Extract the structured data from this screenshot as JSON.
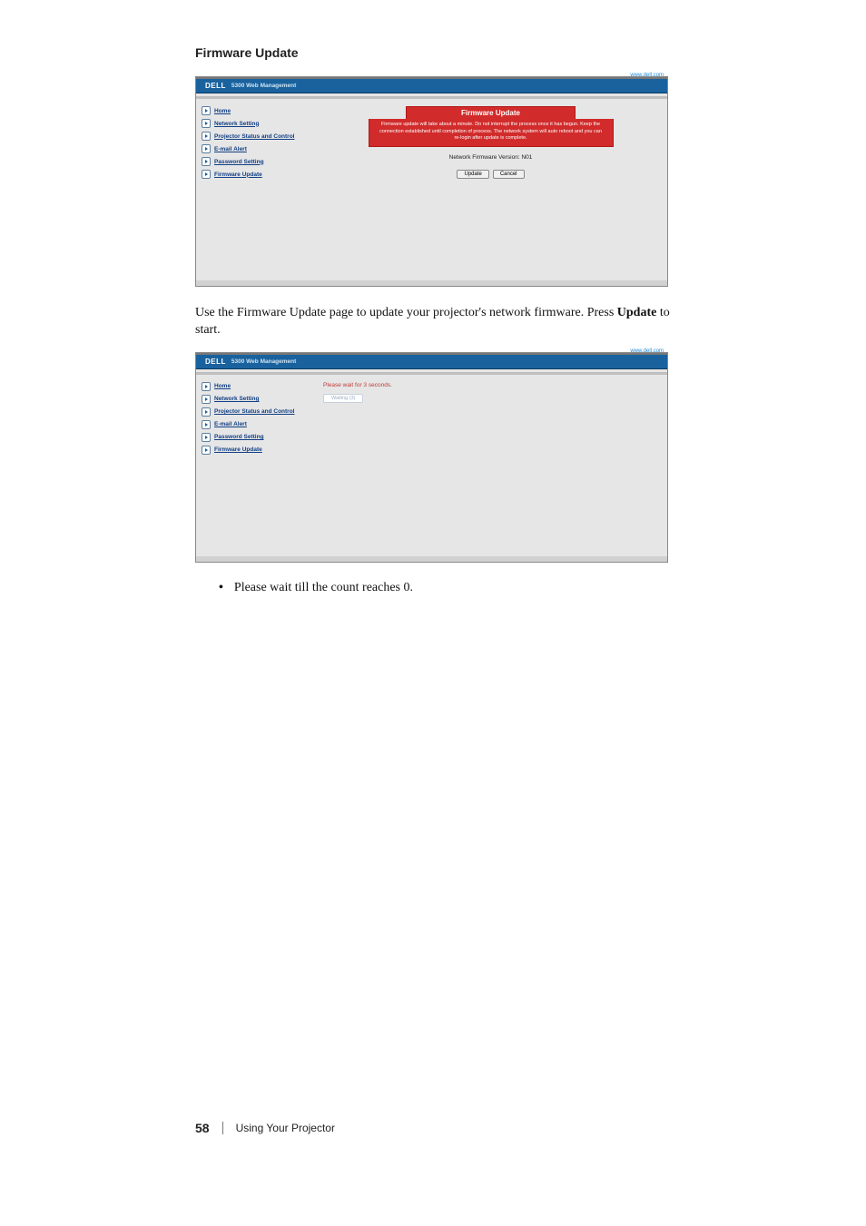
{
  "heading": "Firmware Update",
  "url_label": "www.dell.com",
  "brand": "DELL",
  "appname1": "5300 Web Management",
  "appname2": "5300 Web Management",
  "nav": [
    "Home",
    "Network Setting",
    "Projector Status and Control",
    "E-mail Alert",
    "Password Setting",
    "Firmware Update"
  ],
  "panel": {
    "title": "Firmware Update",
    "warn": "Firmware update will take about a minute. Do not interrupt the process once it has begun. Keep the connection established until completion of process. The network system will auto reboot and you can re-login after update is complete.",
    "version": "Network Firmware Version: N01",
    "btn_update": "Update",
    "btn_cancel": "Cancel"
  },
  "wait_text": "Please wait for 3 seconds.",
  "wait_btn": "Waiting (3)",
  "paragraph_pre": "Use the Firmware Update page to update your projector's network firmware. Press ",
  "paragraph_bold": "Update",
  "paragraph_post": " to start.",
  "bullet": "Please wait till the count reaches 0.",
  "footer": {
    "page": "58",
    "section": "Using Your Projector"
  }
}
